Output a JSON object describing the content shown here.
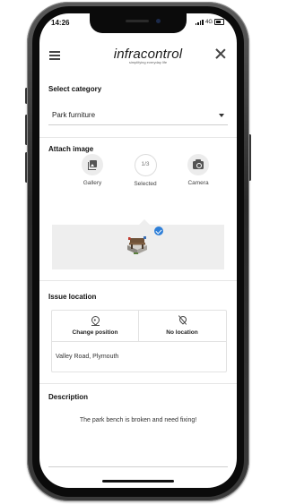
{
  "status_bar": {
    "time": "14:26",
    "network": "4G"
  },
  "header": {
    "logo": "infracontrol",
    "tagline": "simplifying everyday life"
  },
  "category": {
    "label": "Select category",
    "selected": "Park furniture"
  },
  "attach": {
    "label": "Attach image",
    "gallery_label": "Gallery",
    "selected_label": "Selected",
    "selected_count": "1/3",
    "camera_label": "Camera"
  },
  "location": {
    "label": "Issue location",
    "change_position": "Change position",
    "no_location": "No location",
    "address": "Valley Road, Plymouth"
  },
  "description": {
    "label": "Description",
    "text": "The park bench is broken and need fixing!"
  },
  "colors": {
    "accent_blue": "#2e7fd8",
    "frame": "#2a2a2a",
    "strip_bg": "#eeeeee"
  }
}
